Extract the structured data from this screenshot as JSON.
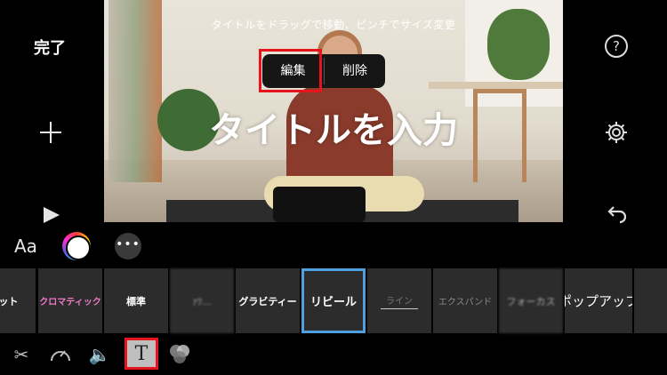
{
  "left_panel": {
    "done_label": "完了"
  },
  "right_panel": {
    "help_label": "?"
  },
  "preview": {
    "hint": "タイトルをドラッグで移動、ピンチでサイズ変更",
    "popover": {
      "edit_label": "編集",
      "delete_label": "削除"
    },
    "title_text": "タイトルを入力"
  },
  "text_controls": {
    "aa_label": "Aa",
    "more_label": "•••"
  },
  "title_styles": [
    {
      "label": "ゲット"
    },
    {
      "label": "クロマティック"
    },
    {
      "label": "標準"
    },
    {
      "label": "ｧﾂ..."
    },
    {
      "label": "グラビティー"
    },
    {
      "label": "リビール",
      "selected": true
    },
    {
      "label": "ライン"
    },
    {
      "label": "エクスパンド"
    },
    {
      "label": "フォーカス"
    },
    {
      "label": "ポップアップ"
    }
  ],
  "toolbar": {
    "scissors_icon": "scissors-icon",
    "speed_icon": "speedometer-icon",
    "volume_icon": "speaker-icon",
    "text_label": "T",
    "filter_icon": "filter-circles-icon"
  },
  "colors": {
    "highlight": "#e8141b",
    "selected_tile": "#4ea1e0",
    "tile_bg": "#2c2c2c"
  }
}
